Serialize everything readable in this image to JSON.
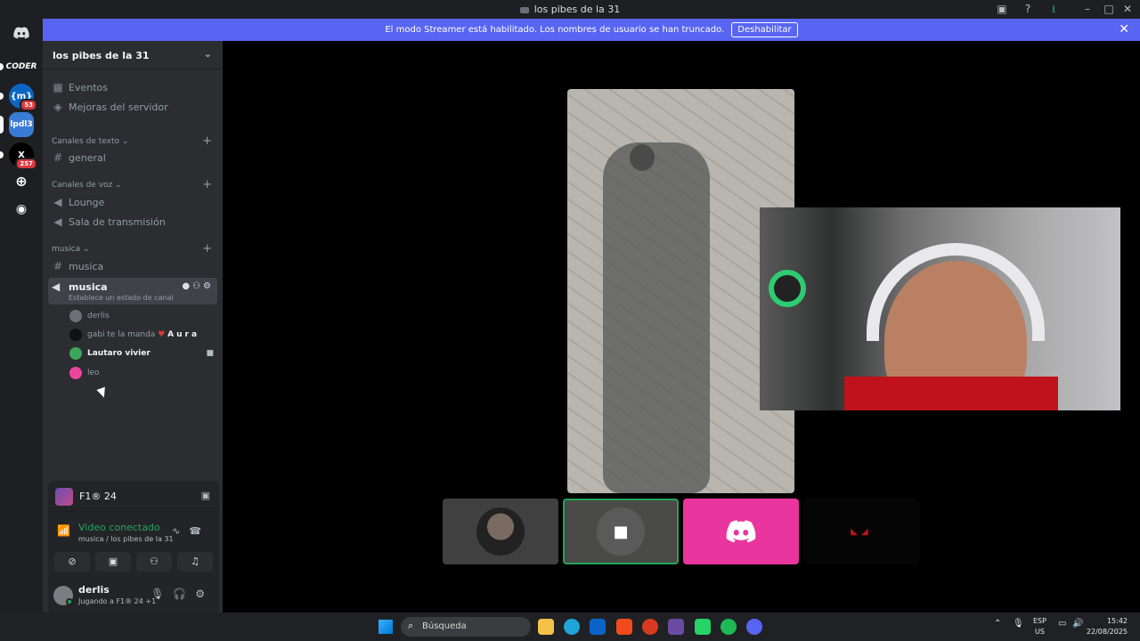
{
  "window": {
    "title": "los pibes de la 31"
  },
  "banner": {
    "text": "El modo Streamer está habilitado. Los nombres de usuario se han truncado.",
    "button": "Deshabilitar"
  },
  "rail": {
    "servers": [
      {
        "label": "CODER",
        "color": "#1e1f22"
      },
      {
        "label": "{m}",
        "color": "#0b66c3",
        "badge": "53"
      },
      {
        "label": "lpdl3",
        "color": "#3a7bd5"
      },
      {
        "label": "X",
        "color": "#000000",
        "badge": "257"
      }
    ]
  },
  "sidebar": {
    "server_name": "los pibes de la 31",
    "events": "Eventos",
    "boosts": "Mejoras del servidor",
    "text_category": "Canales de texto",
    "text_channel": "general",
    "voice_category": "Canales de voz",
    "voice_channels": [
      "Lounge",
      "Sala de transmisión"
    ],
    "music_category": "musica",
    "music_text": "musica",
    "active_voice": {
      "name": "musica",
      "status": "Establece un estado de canal"
    },
    "members": [
      {
        "name": "derlis",
        "color": "#6d6f78"
      },
      {
        "name": "gabi te la manda",
        "tag": "Aura",
        "color": "#111111"
      },
      {
        "name": "Lautaro vivier",
        "color": "#3ba55c"
      },
      {
        "name": "leo",
        "color": "#eb459e"
      }
    ]
  },
  "panel": {
    "activity_name": "F1® 24",
    "voice_status": "Video conectado",
    "voice_location": "musica / los pibes de la 31",
    "user": "derlis",
    "user_activity": "Jugando a F1® 24 +1"
  },
  "taskbar": {
    "search": "Búsqueda",
    "lang_top": "ESP",
    "lang_bottom": "US",
    "time": "15:42",
    "date": "22/08/2025"
  },
  "colors": {
    "accent": "#5865f2",
    "connected": "#23a55a",
    "pink_tile": "#e9359e"
  }
}
